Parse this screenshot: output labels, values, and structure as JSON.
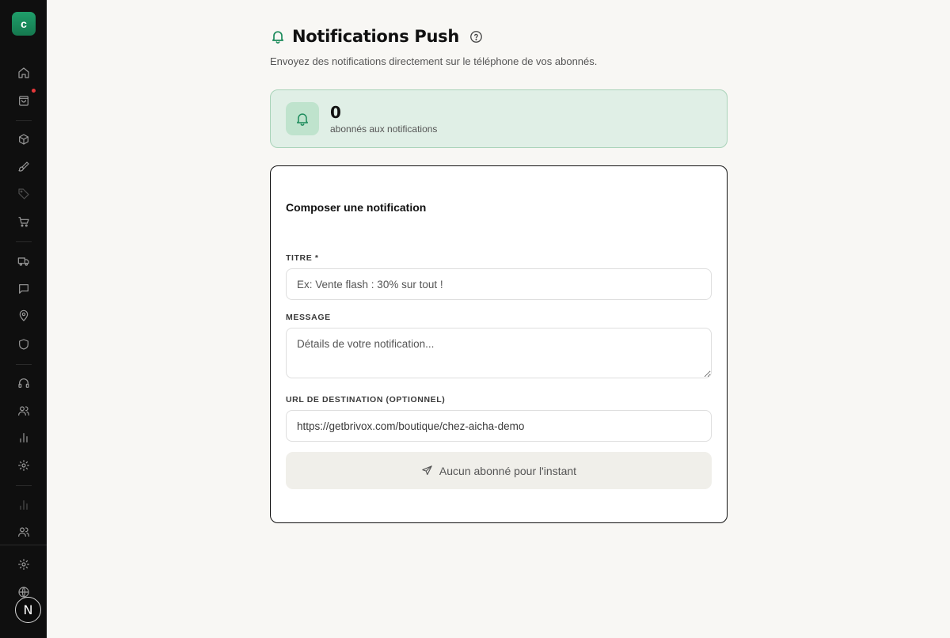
{
  "sidebar": {
    "logo_letter": "c",
    "avatar_letter": "N",
    "icons": [
      "home-icon",
      "shopping-bag-icon",
      "box-icon",
      "brush-icon",
      "tag-icon",
      "cart-icon",
      "truck-icon",
      "message-icon",
      "map-pin-icon",
      "shield-icon",
      "headphones-icon",
      "users-icon",
      "bar-chart-icon",
      "settings-icon",
      "bar-chart-icon",
      "users-icon",
      "settings-icon",
      "globe-icon"
    ]
  },
  "header": {
    "title": "Notifications Push",
    "subtitle": "Envoyez des notifications directement sur le téléphone de vos abonnés."
  },
  "stats": {
    "count": "0",
    "label": "abonnés aux notifications"
  },
  "compose": {
    "title": "Composer une notification",
    "title_field": {
      "label": "TITRE *",
      "value": "",
      "placeholder": "Ex: Vente flash : 30% sur tout !"
    },
    "message_field": {
      "label": "MESSAGE",
      "value": "",
      "placeholder": "Détails de votre notification..."
    },
    "url_field": {
      "label": "URL DE DESTINATION (OPTIONNEL)",
      "value": "https://getbrivox.com/boutique/chez-aicha-demo",
      "placeholder": ""
    },
    "submit_label": "Aucun abonné pour l'instant"
  },
  "colors": {
    "accent": "#1a8a5a",
    "stats_background": "#e0efe6",
    "sidebar_background": "#0f0f0f",
    "notification_dot": "#e5383b"
  }
}
